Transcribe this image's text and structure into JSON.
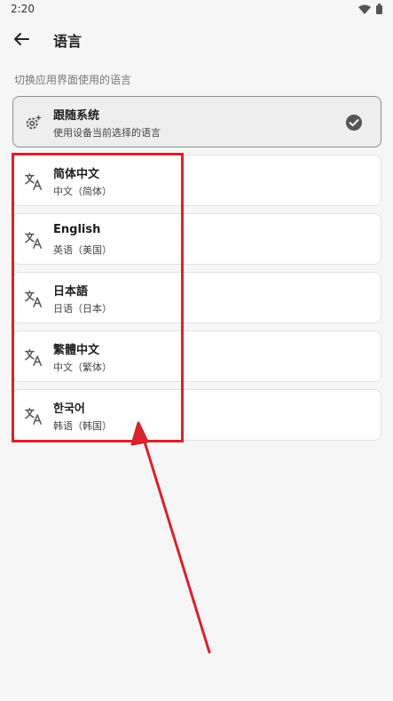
{
  "status_bar": {
    "time": "2:20"
  },
  "app_bar": {
    "title": "语言"
  },
  "section_hint": "切换应用界面使用的语言",
  "options": [
    {
      "title": "跟随系统",
      "subtitle": "使用设备当前选择的语言",
      "selected": true,
      "icon": "settings-auto-icon"
    },
    {
      "title": "简体中文",
      "subtitle": "中文（简体）",
      "selected": false,
      "icon": "translate-icon"
    },
    {
      "title": "English",
      "subtitle": "英语（美国）",
      "selected": false,
      "icon": "translate-icon"
    },
    {
      "title": "日本語",
      "subtitle": "日语（日本）",
      "selected": false,
      "icon": "translate-icon"
    },
    {
      "title": "繁體中文",
      "subtitle": "中文（繁体）",
      "selected": false,
      "icon": "translate-icon"
    },
    {
      "title": "한국어",
      "subtitle": "韩语（韩国）",
      "selected": false,
      "icon": "translate-icon"
    }
  ],
  "colors": {
    "annotation": "#d6232c",
    "selected_bg": "#eeeeee",
    "card_bg": "#ffffff",
    "page_bg": "#f6f6f6"
  }
}
